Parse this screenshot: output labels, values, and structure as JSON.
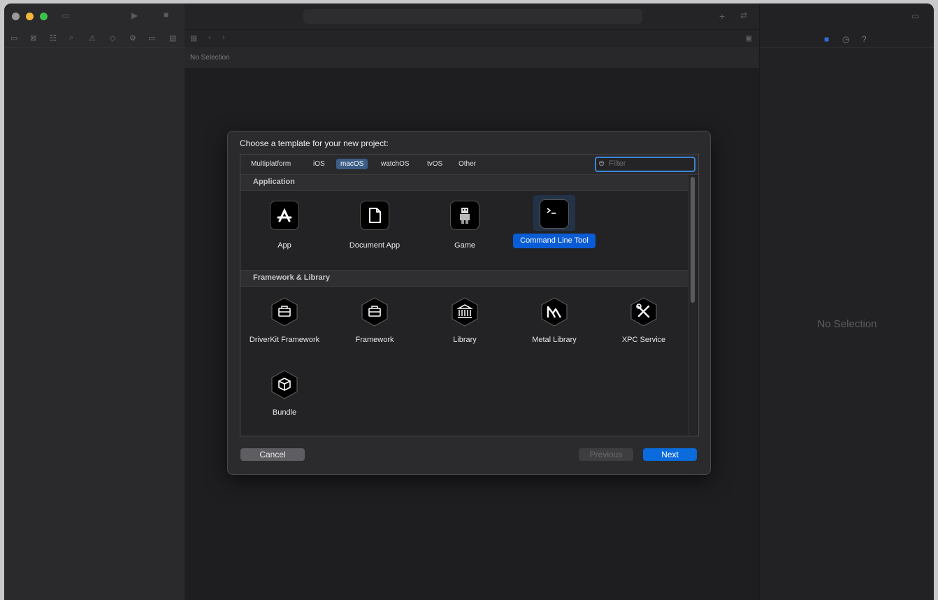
{
  "editor": {
    "breadcrumb": "No Selection"
  },
  "inspector": {
    "empty_text": "No Selection"
  },
  "dialog": {
    "title": "Choose a template for your new project:",
    "platform_tabs": [
      "Multiplatform",
      "iOS",
      "macOS",
      "watchOS",
      "tvOS",
      "Other"
    ],
    "active_tab": "macOS",
    "filter_placeholder": "Filter",
    "sections": {
      "application": {
        "header": "Application",
        "templates": [
          "App",
          "Document App",
          "Game",
          "Command Line Tool"
        ]
      },
      "framework_library": {
        "header": "Framework & Library",
        "templates": [
          "DriverKit Framework",
          "Framework",
          "Library",
          "Metal Library",
          "XPC Service",
          "Bundle"
        ]
      }
    },
    "selected_template": "Command Line Tool",
    "buttons": {
      "cancel": "Cancel",
      "previous": "Previous",
      "next": "Next"
    }
  },
  "colors": {
    "accent": "#0b6bdc",
    "selection": "#0a5cd6",
    "window_bg": "#1e1e20"
  },
  "icons": {
    "app": "app-store-a-icon",
    "document_app": "document-icon",
    "game": "game-robot-icon",
    "command_line_tool": "terminal-icon",
    "driverkit": "toolbox-icon",
    "framework": "toolbox-icon",
    "library": "building-icon",
    "metal_library": "metal-icon",
    "xpc_service": "wrench-screwdriver-icon",
    "bundle": "cube-icon"
  }
}
